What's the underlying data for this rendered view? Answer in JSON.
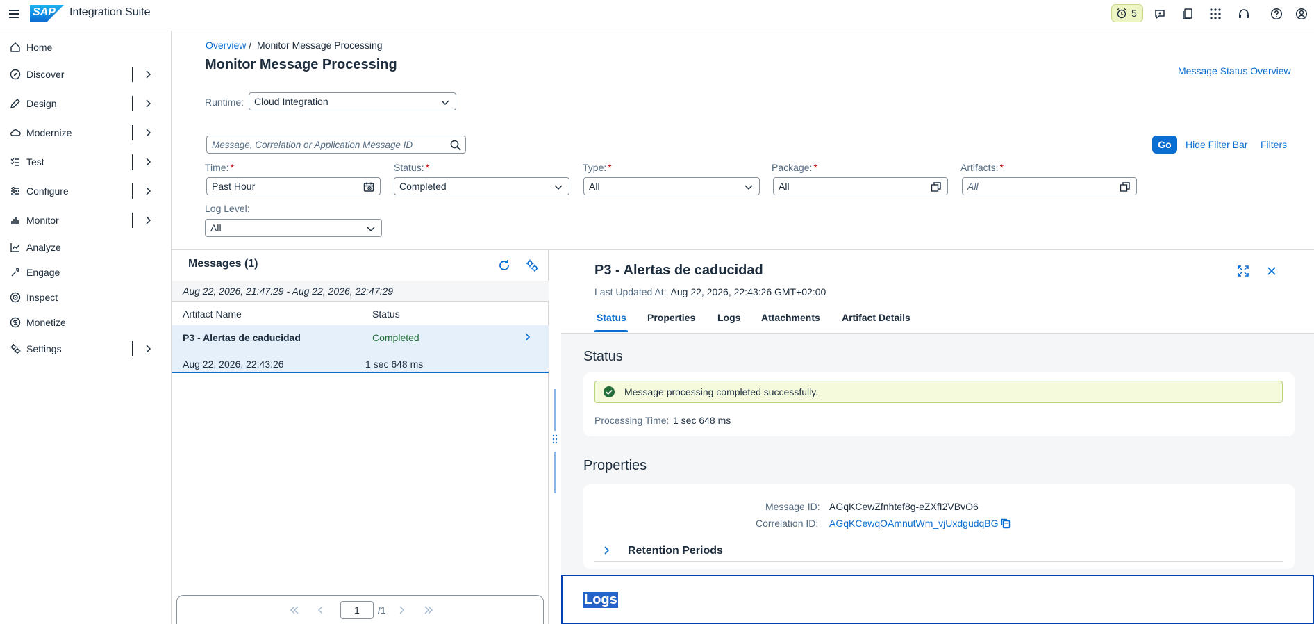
{
  "shell": {
    "logo_text": "SAP",
    "title": "Integration Suite",
    "notification_count": "5"
  },
  "sidenav": {
    "items": [
      {
        "label": "Home",
        "icon": "home-icon"
      },
      {
        "label": "Discover",
        "icon": "compass-icon"
      },
      {
        "label": "Design",
        "icon": "pencil-icon"
      },
      {
        "label": "Modernize",
        "icon": "cloud-icon"
      },
      {
        "label": "Test",
        "icon": "checklist-icon"
      },
      {
        "label": "Configure",
        "icon": "sliders-icon"
      },
      {
        "label": "Monitor",
        "icon": "bar-chart-icon"
      },
      {
        "label": "Analyze",
        "icon": "line-chart-icon"
      },
      {
        "label": "Engage",
        "icon": "wrench-icon"
      },
      {
        "label": "Inspect",
        "icon": "radar-icon"
      },
      {
        "label": "Monetize",
        "icon": "dollar-icon"
      },
      {
        "label": "Settings",
        "icon": "settings-icon"
      }
    ]
  },
  "header": {
    "breadcrumb_link": "Overview",
    "breadcrumb_sep": "/",
    "breadcrumb_current": "Monitor Message Processing",
    "title": "Monitor Message Processing",
    "status_overview_link": "Message Status Overview"
  },
  "filters": {
    "runtime_label": "Runtime:",
    "runtime_value": "Cloud Integration",
    "search_placeholder": "Message, Correlation or Application Message ID",
    "go_label": "Go",
    "hide_filter_bar_label": "Hide Filter Bar",
    "filters_label": "Filters",
    "time_label": "Time:",
    "time_value": "Past Hour",
    "status_label": "Status:",
    "status_value": "Completed",
    "type_label": "Type:",
    "type_value": "All",
    "package_label": "Package:",
    "package_value": "All",
    "artifacts_label": "Artifacts:",
    "artifacts_placeholder": "All",
    "log_level_label": "Log Level:",
    "log_level_value": "All",
    "required_marker": "*"
  },
  "messages": {
    "title": "Messages (1)",
    "time_range": "Aug 22, 2026, 21:47:29 - Aug 22, 2026, 22:47:29",
    "col_artifact": "Artifact Name",
    "col_status": "Status",
    "rows": [
      {
        "artifact": "P3 - Alertas de caducidad",
        "status": "Completed",
        "timestamp": "Aug 22, 2026, 22:43:26",
        "duration": "1 sec 648 ms"
      }
    ],
    "pager": {
      "page": "1",
      "total": "/1"
    }
  },
  "detail": {
    "title": "P3 - Alertas de caducidad",
    "last_updated_label": "Last Updated At:",
    "last_updated_value": "Aug 22, 2026, 22:43:26 GMT+02:00",
    "tabs": [
      "Status",
      "Properties",
      "Logs",
      "Attachments",
      "Artifact Details"
    ],
    "status_section_title": "Status",
    "status_message": "Message processing completed successfully.",
    "processing_time_label": "Processing Time:",
    "processing_time_value": "1 sec 648 ms",
    "properties_section_title": "Properties",
    "message_id_label": "Message ID:",
    "message_id_value": "AGqKCewZfnhtef8g-eZXfI2VBvO6",
    "correlation_id_label": "Correlation ID:",
    "correlation_id_value": "AGqKCewqOAmnutWm_vjUxdgudqBG",
    "retention_label": "Retention Periods",
    "logs_section_title": "Logs"
  },
  "colors": {
    "accent": "#0a6ed1",
    "success": "#256f3a",
    "text": "#1d2d3e",
    "required": "#bb0000"
  }
}
